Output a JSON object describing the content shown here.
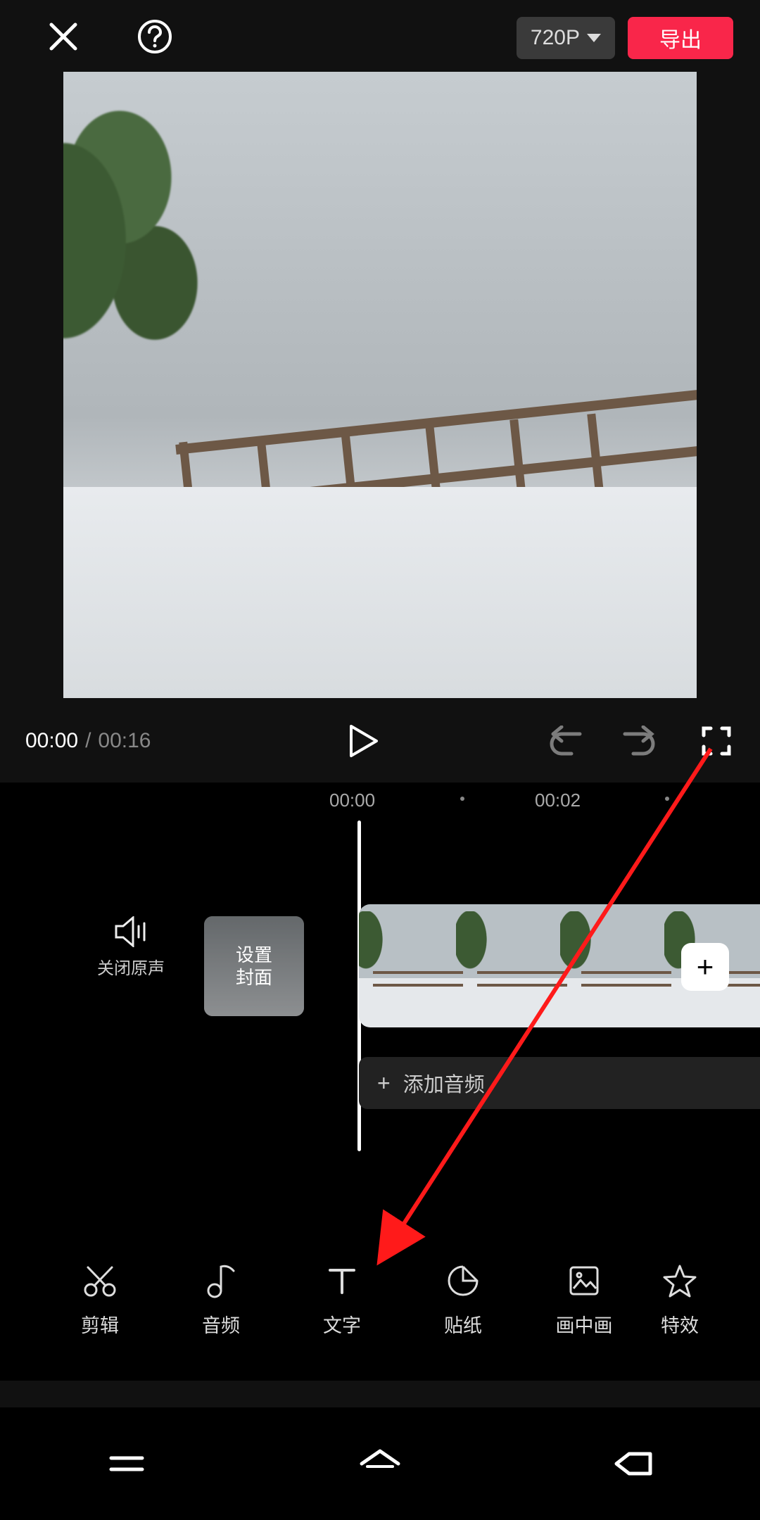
{
  "colors": {
    "accent": "#F9264A",
    "bg": "#000",
    "chip": "#3a3a3a"
  },
  "top": {
    "resolution": "720P",
    "export_label": "导出"
  },
  "playback": {
    "current_time": "00:00",
    "separator": "/",
    "total_time": "00:16"
  },
  "ruler": {
    "tick0": "00:00",
    "tick1": "00:02"
  },
  "timeline": {
    "mute_label": "关闭原声",
    "cover_label": "设置\n封面",
    "add_audio_label": "添加音频",
    "add_clip_symbol": "+"
  },
  "tools": [
    {
      "name": "cut",
      "label": "剪辑",
      "icon": "scissors-icon"
    },
    {
      "name": "audio",
      "label": "音频",
      "icon": "music-note-icon"
    },
    {
      "name": "text",
      "label": "文字",
      "icon": "text-icon"
    },
    {
      "name": "sticker",
      "label": "贴纸",
      "icon": "sticker-icon"
    },
    {
      "name": "pip",
      "label": "画中画",
      "icon": "image-in-image-icon"
    },
    {
      "name": "effect",
      "label": "特效",
      "icon": "star-icon"
    }
  ],
  "annotation": {
    "type": "arrow",
    "target": "tool-text"
  }
}
